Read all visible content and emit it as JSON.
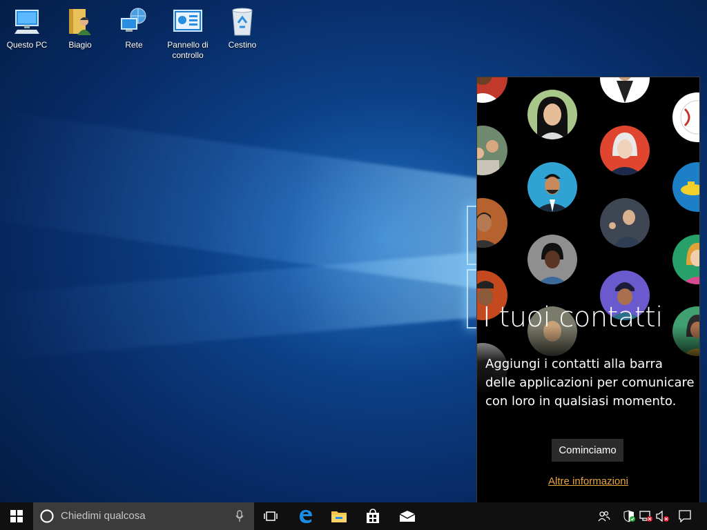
{
  "desktop": {
    "icons": [
      {
        "label": "Questo PC",
        "icon": "computer-icon"
      },
      {
        "label": "Biagio",
        "icon": "user-folder-icon"
      },
      {
        "label": "Rete",
        "icon": "network-icon"
      },
      {
        "label": "Pannello di controllo",
        "icon": "control-panel-icon"
      },
      {
        "label": "Cestino",
        "icon": "recycle-bin-icon"
      }
    ]
  },
  "people_panel": {
    "title": "I tuoi contatti",
    "description": "Aggiungi i contatti alla barra delle applicazioni per comunicare con loro in qualsiasi momento.",
    "primary_button": "Cominciamo",
    "link": "Altre informazioni",
    "link_color": "#e8a53a"
  },
  "taskbar": {
    "search_placeholder": "Chiedimi qualcosa",
    "pinned": [
      "task-view-icon",
      "edge-icon",
      "file-explorer-icon",
      "store-icon",
      "mail-icon"
    ],
    "tray": [
      "people-icon",
      "defender-icon",
      "network-disconnected-icon",
      "volume-muted-icon",
      "action-center-icon"
    ]
  },
  "colors": {
    "taskbar": "#101010",
    "search_box": "#3b3b3b",
    "accent": "#0078d7"
  }
}
